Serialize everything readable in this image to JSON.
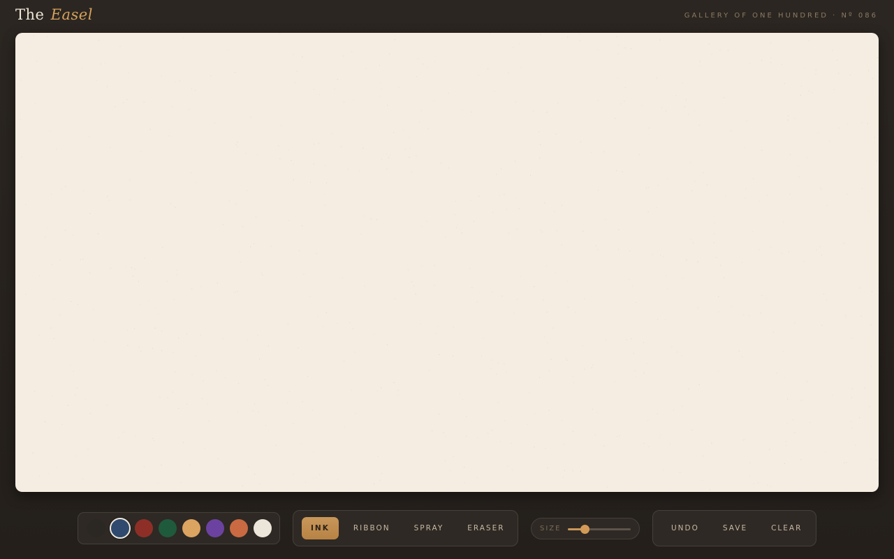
{
  "header": {
    "logo_prefix": "The",
    "logo_accent": "Easel",
    "gallery_label": "GALLERY OF ONE HUNDRED · Nº 086"
  },
  "canvas": {
    "background": "#f5ede2"
  },
  "palette": {
    "selected_index": 1,
    "colors": [
      "#2b2722",
      "#2f4a6e",
      "#8e2f27",
      "#1f5a3d",
      "#dca461",
      "#6c42a0",
      "#c96a42",
      "#ece6da"
    ]
  },
  "tools": {
    "active": "INK",
    "items": [
      "INK",
      "RIBBON",
      "SPRAY",
      "ERASER"
    ]
  },
  "size": {
    "label": "SIZE",
    "value_fraction": 0.26
  },
  "actions": {
    "undo": "UNDO",
    "save": "SAVE",
    "clear": "CLEAR"
  },
  "colors": {
    "accent": "#c9975a",
    "background": "#28231f",
    "panel": "#2e2924"
  }
}
